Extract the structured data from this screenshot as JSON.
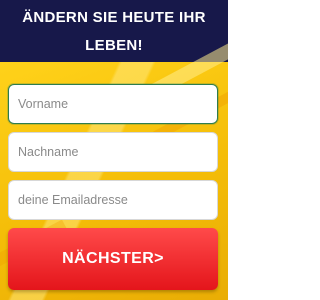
{
  "header": {
    "line1": "ÄNDERN SIE HEUTE IHR",
    "line2": "LEBEN!"
  },
  "form": {
    "first_name_placeholder": "Vorname",
    "last_name_placeholder": "Nachname",
    "email_placeholder": "deine Emailadresse",
    "submit_label": "NÄCHSTER>"
  },
  "colors": {
    "header_bg": "#17184a",
    "background": "#f6c20e",
    "button": "#e4151b",
    "focused_border": "#2e7d4f"
  }
}
